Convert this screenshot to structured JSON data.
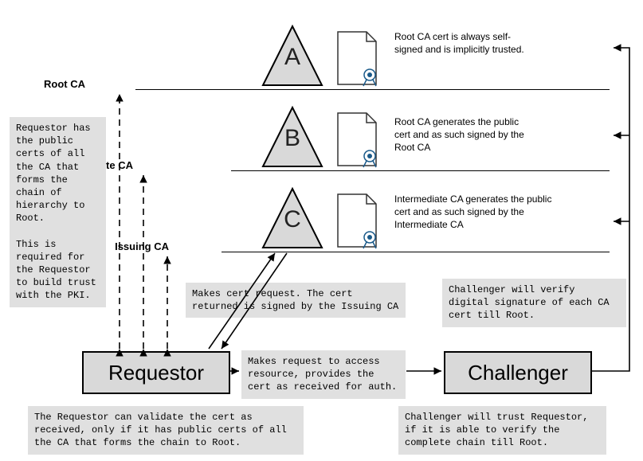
{
  "ca": {
    "root": {
      "label": "Root CA",
      "letter": "A",
      "desc": "Root CA cert is always self-signed and is implicitly trusted."
    },
    "inter": {
      "label": "Intermediate CA",
      "letter": "B",
      "desc": "Root CA generates the public cert and as such signed by the Root CA"
    },
    "issuing": {
      "label": "Issuing CA",
      "letter": "C",
      "desc": "Intermediate CA generates the public cert and as such signed by the Intermediate CA"
    }
  },
  "actors": {
    "requestor": "Requestor",
    "challenger": "Challenger"
  },
  "notes": {
    "requestor_pki": "Requestor has the public certs of all the CA that forms the chain of hierarchy to Root.\n\nThis is required for the Requestor to build trust with the PKI.",
    "cert_request": "Makes cert request. The cert returned is signed by the Issuing CA",
    "access_request": "Makes request to access resource, provides the cert as received for auth.",
    "requestor_validate": "The Requestor can validate the cert as received, only if it has public certs of all the CA that forms the chain to Root.",
    "challenger_verify": "Challenger will verify digital signature of each CA cert till Root.",
    "challenger_trust": "Challenger will trust Requestor, if it is able to verify the complete chain till Root."
  }
}
